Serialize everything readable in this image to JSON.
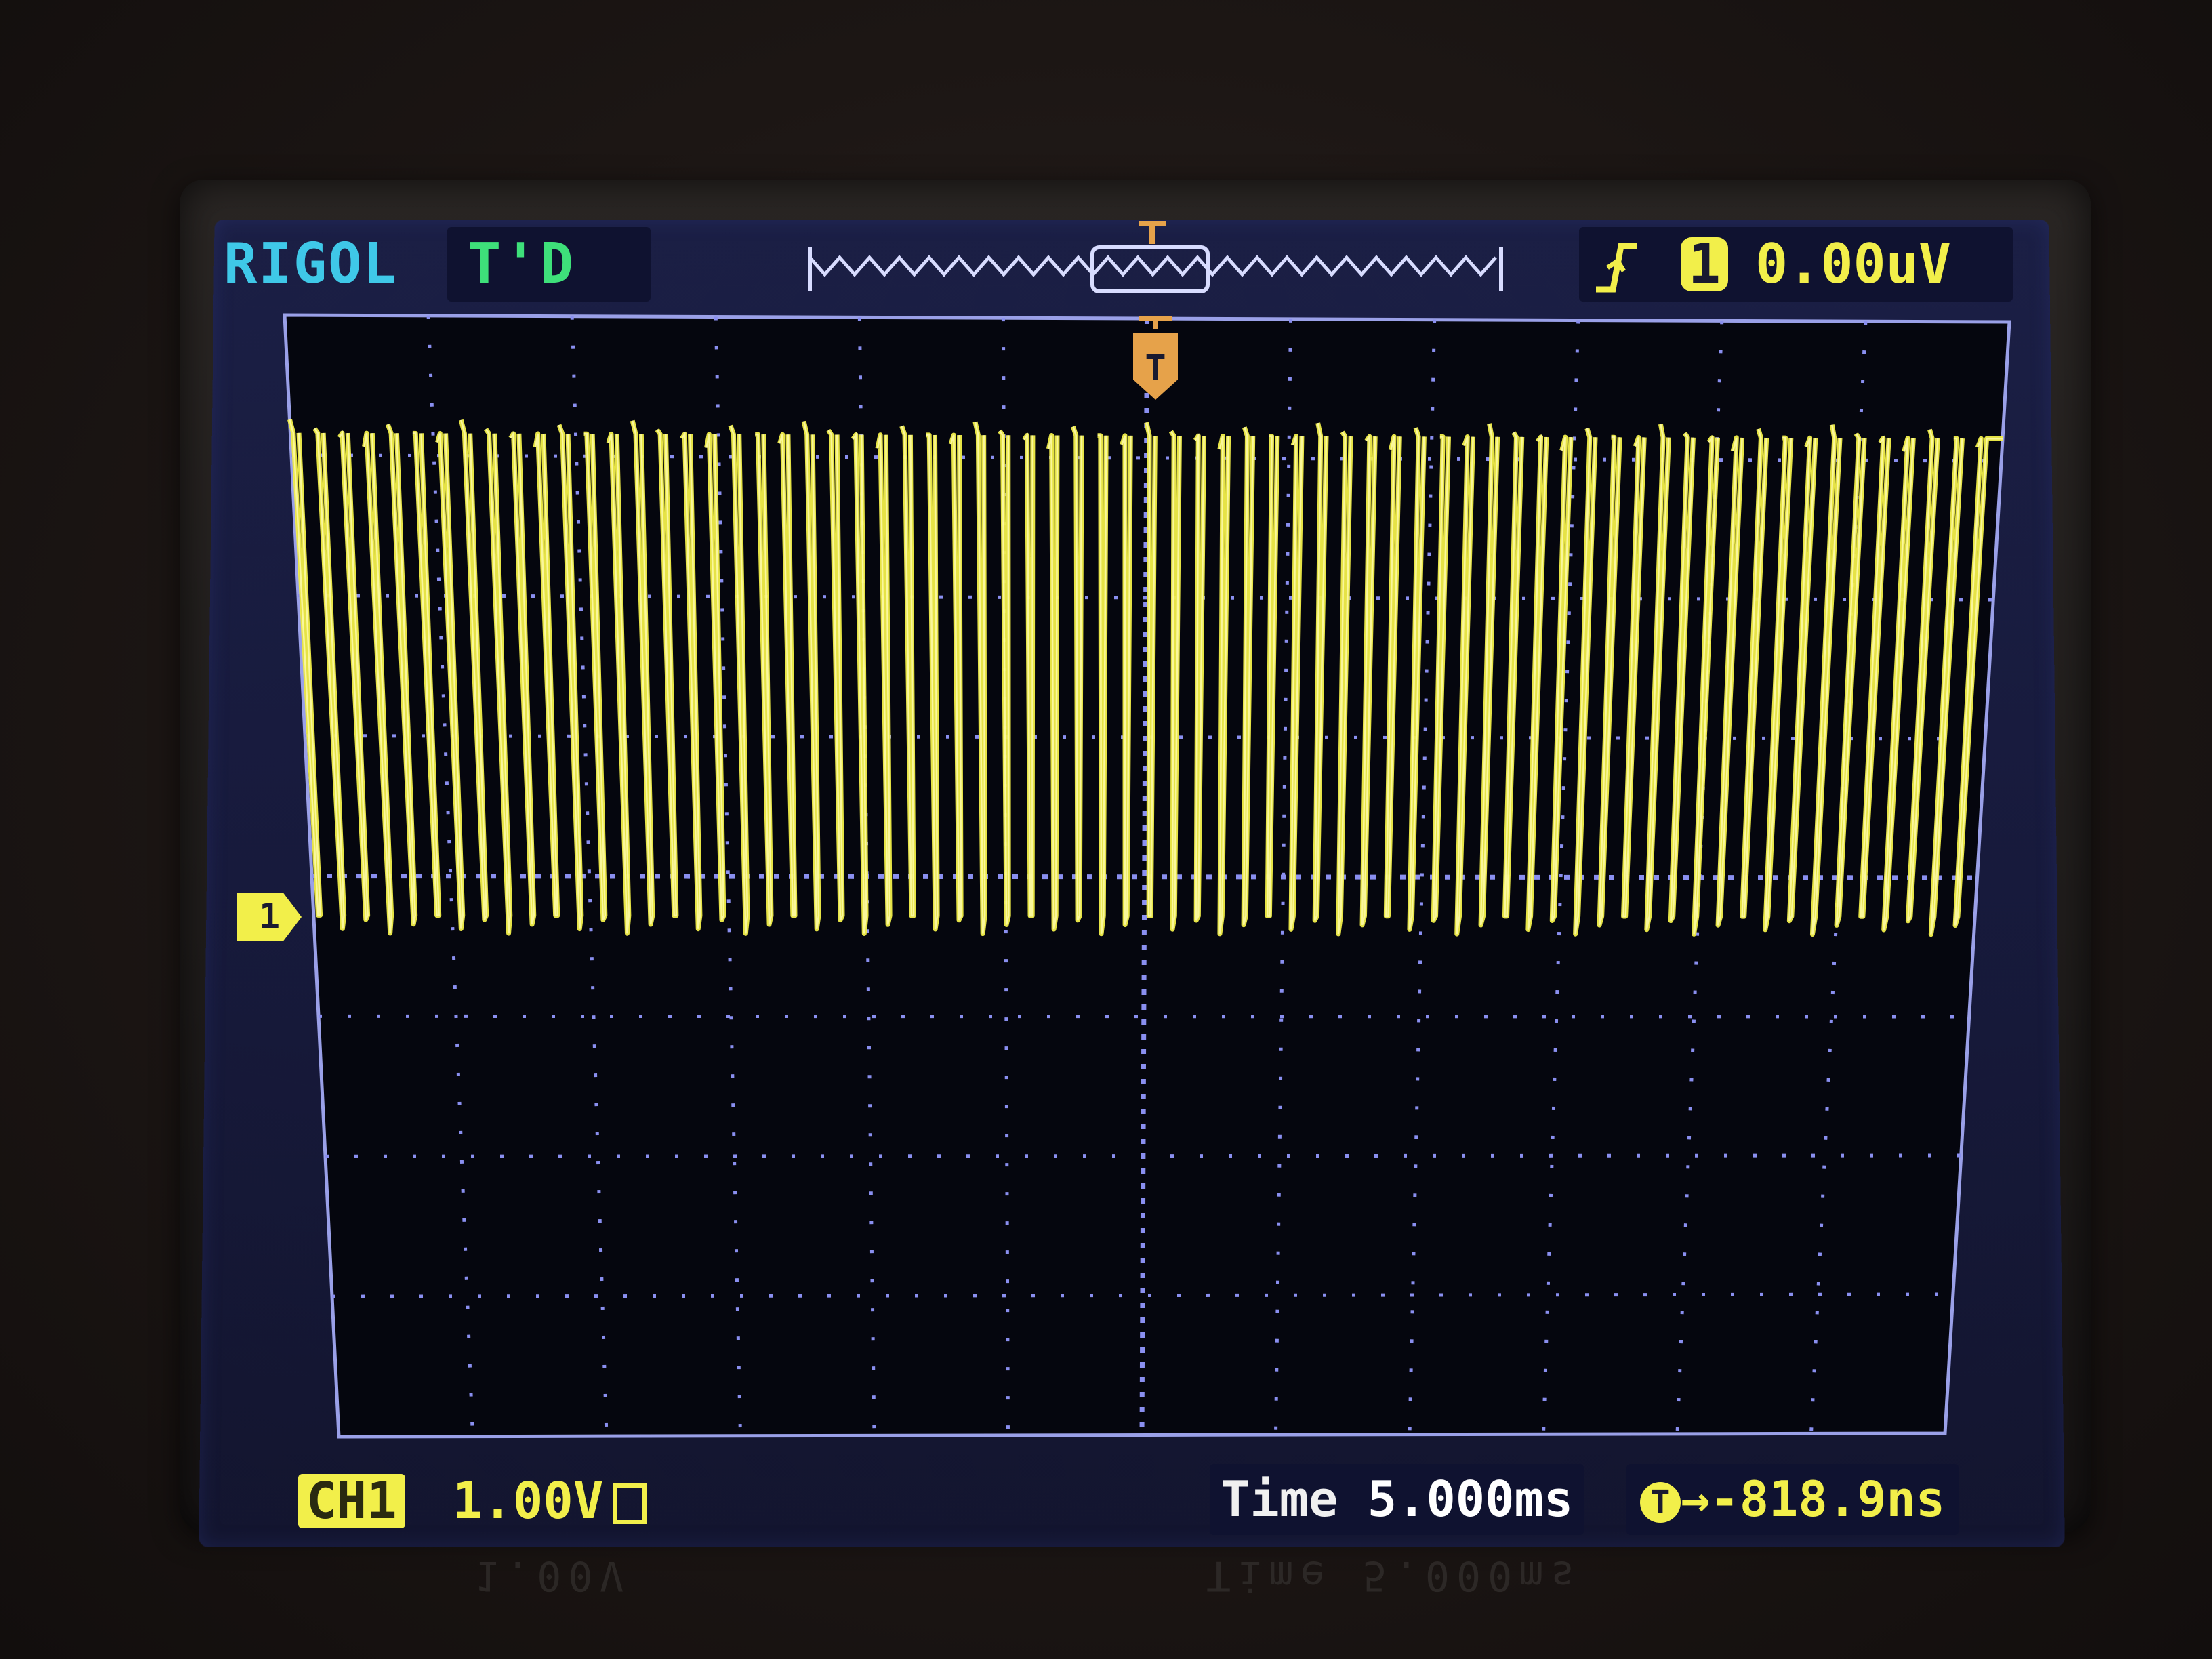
{
  "header": {
    "brand": "RIGOL",
    "trigger_status": "T'D",
    "trigger_level": "0.00uV",
    "trigger_channel": "1"
  },
  "footer": {
    "channel_tag": "CH1",
    "channel_scale": "1.00V",
    "time_label": "Time",
    "time_value": "5.000ms",
    "trigger_offset": "→-818.9ns"
  },
  "channel_marker": "1",
  "colors": {
    "trace": "#f2ef4a",
    "grid": "#8a8ff0",
    "screen": "#171a3c",
    "brand": "#3fc8e8",
    "status": "#3ee07a"
  },
  "icons": {
    "trigger_edge": "rising-edge-icon",
    "memory_bar": "waveform-memory-icon",
    "trigger_position": "trigger-T-marker-icon"
  },
  "waveform": {
    "pulse_count": 70,
    "high_level_div": 3.6,
    "low_level_div": 0.0
  }
}
